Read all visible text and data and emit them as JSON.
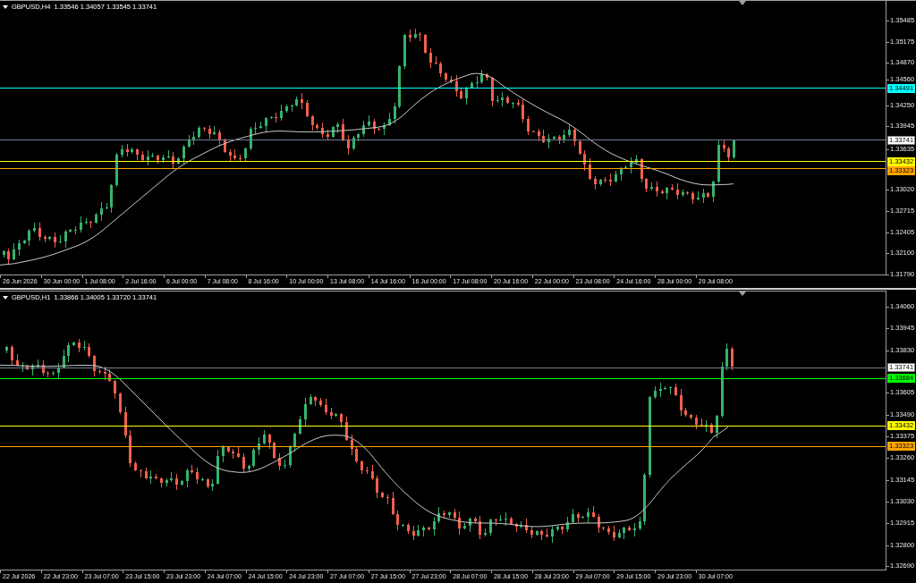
{
  "charts": [
    {
      "header": "GBPUSD,H4  1.33546 1.34057 1.33545 1.33741",
      "price_ticks": [
        "1.35485",
        "1.35175",
        "1.34870",
        "1.34560",
        "1.34250",
        "1.33945",
        "1.33635",
        "1.33020",
        "1.32715",
        "1.32405",
        "1.32100",
        "1.31790"
      ],
      "price_lines": [
        {
          "kind": "level",
          "label": "1.34491",
          "color": "#00ffff"
        },
        {
          "kind": "bid",
          "label": "1.33741",
          "color": "#ffffff"
        },
        {
          "kind": "level",
          "label": "1.33432",
          "color": "#ffff00"
        },
        {
          "kind": "level",
          "label": "1.33323",
          "color": "#ffa500"
        }
      ],
      "time_labels": [
        "26 Jun 2026",
        "30 Jun 00:00",
        "1 Jul 08:00",
        "2 Jul 16:00",
        "6 Jul 00:00",
        "7 Jul 08:00",
        "8 Jul 16:00",
        "10 Jul 00:00",
        "13 Jul 08:00",
        "14 Jul 16:00",
        "16 Jul 00:00",
        "17 Jul 08:00",
        "20 Jul 16:00",
        "22 Jul 00:00",
        "23 Jul 08:00",
        "24 Jul 16:00",
        "28 Jul 00:00",
        "29 Jul 08:00"
      ]
    },
    {
      "header": "GBPUSD,H1  1.33866 1.34005 1.33720 1.33741",
      "price_ticks": [
        "1.34060",
        "1.33945",
        "1.33830",
        "1.33605",
        "1.33490",
        "1.33375",
        "1.33260",
        "1.33145",
        "1.33030",
        "1.32915",
        "1.32800",
        "1.32690"
      ],
      "price_lines": [
        {
          "kind": "bid",
          "label": "1.33741",
          "color": "#ffffff"
        },
        {
          "kind": "level",
          "label": "1.33684",
          "color": "#00ff00"
        },
        {
          "kind": "level",
          "label": "1.33432",
          "color": "#ffff00"
        },
        {
          "kind": "level",
          "label": "1.33323",
          "color": "#ffa500"
        }
      ],
      "time_labels": [
        "22 Jul 2026",
        "22 Jul 23:00",
        "23 Jul 07:00",
        "23 Jul 15:00",
        "23 Jul 23:00",
        "24 Jul 07:00",
        "24 Jul 15:00",
        "24 Jul 23:00",
        "27 Jul 07:00",
        "27 Jul 15:00",
        "27 Jul 23:00",
        "28 Jul 07:00",
        "28 Jul 15:00",
        "28 Jul 23:00",
        "29 Jul 07:00",
        "29 Jul 15:00",
        "29 Jul 23:00",
        "30 Jul 07:00"
      ]
    }
  ]
}
